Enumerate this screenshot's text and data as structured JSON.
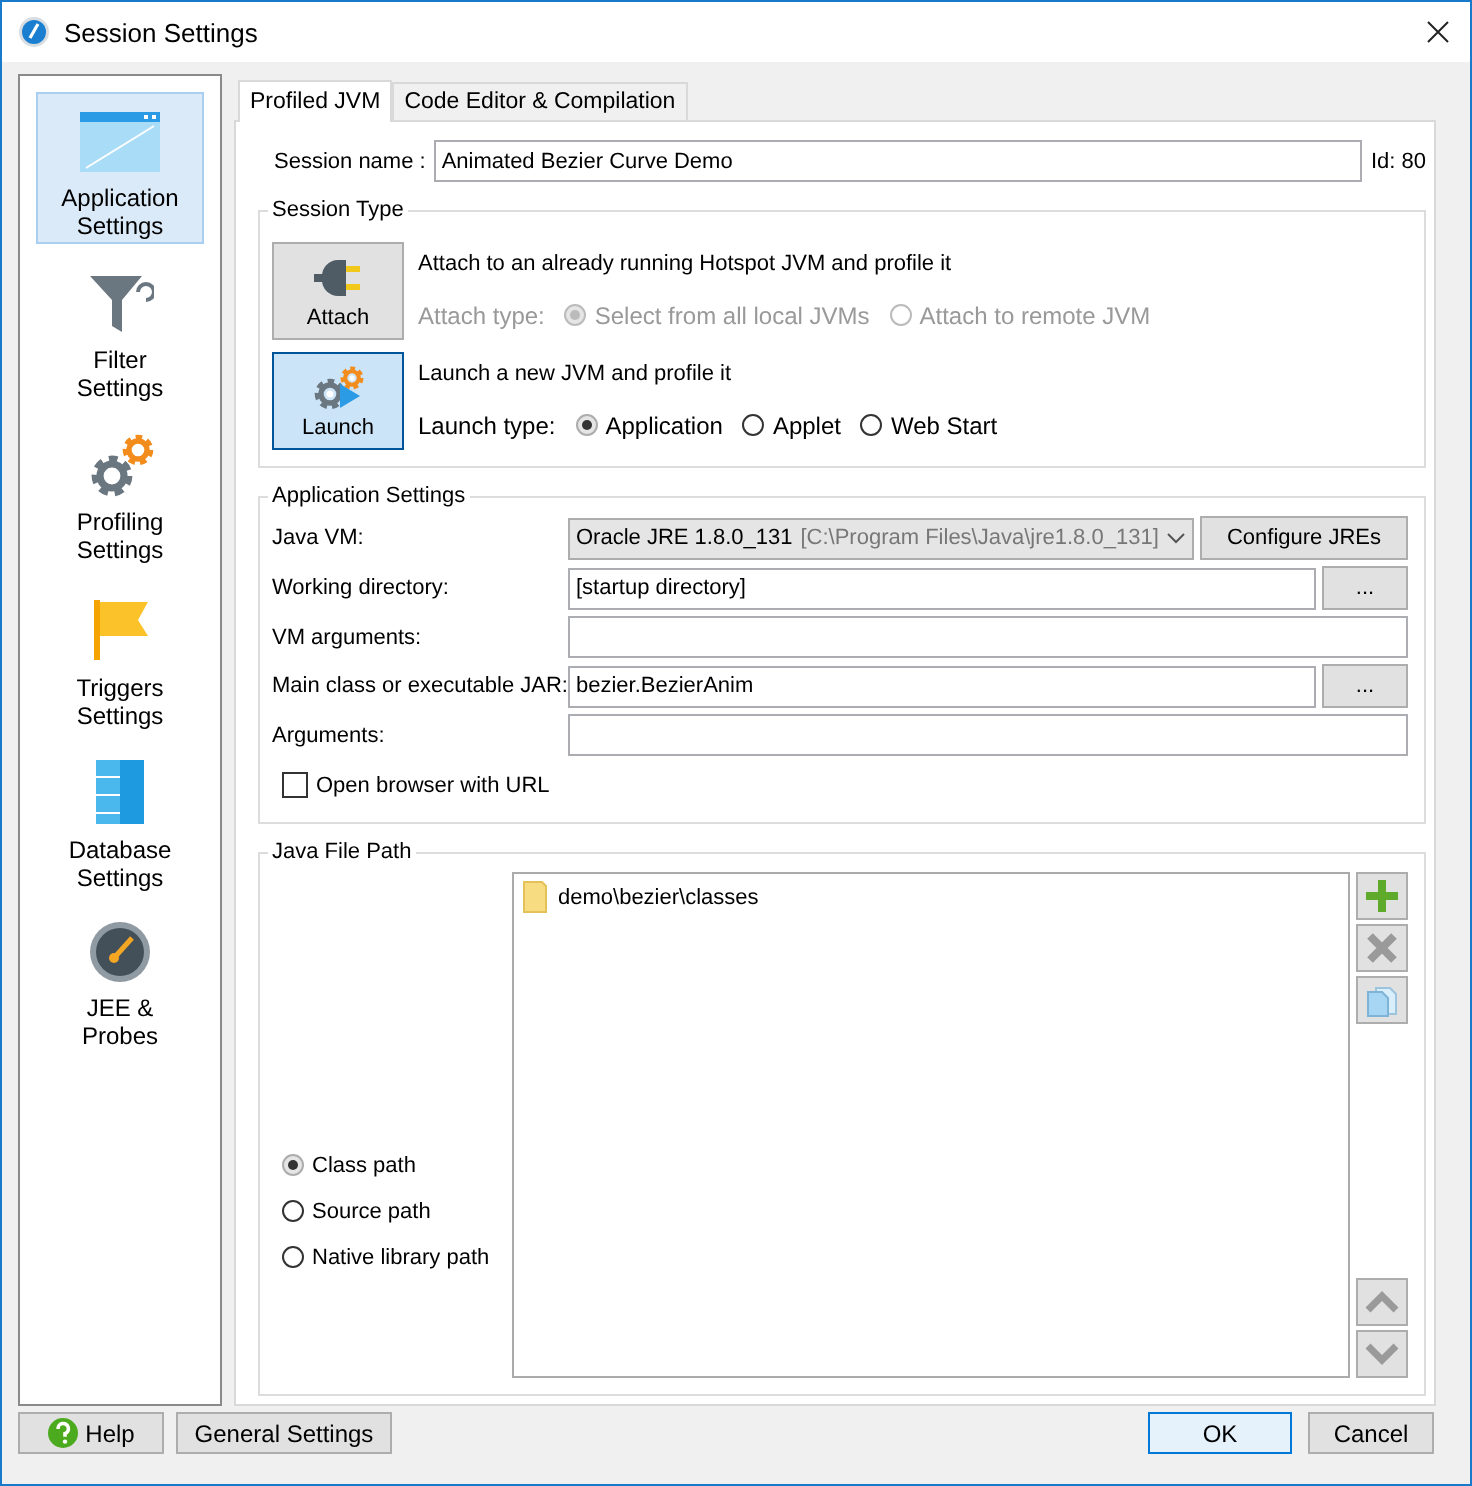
{
  "window": {
    "title": "Session Settings"
  },
  "sidebar": {
    "items": [
      {
        "kind": "window",
        "label": "Application\nSettings",
        "selected": true
      },
      {
        "kind": "filter",
        "label": "Filter\nSettings",
        "selected": false
      },
      {
        "kind": "gears",
        "label": "Profiling\nSettings",
        "selected": false
      },
      {
        "kind": "flag",
        "label": "Triggers\nSettings",
        "selected": false
      },
      {
        "kind": "database",
        "label": "Database\nSettings",
        "selected": false
      },
      {
        "kind": "gauge",
        "label": "JEE &\nProbes",
        "selected": false
      }
    ]
  },
  "tabs": [
    {
      "label": "Profiled JVM",
      "selected": true
    },
    {
      "label": "Code Editor & Compilation",
      "selected": false
    }
  ],
  "session": {
    "label": "Session name :",
    "value": "Animated Bezier Curve Demo",
    "id": "Id: 80"
  },
  "session_type": {
    "title": "Session Type",
    "modes": [
      {
        "kind": "attach",
        "button": "Attach",
        "selected": false,
        "description": "Attach to an already running Hotspot JVM and profile it",
        "type_label": "Attach type:",
        "disabled": true,
        "options": [
          {
            "label": "Select from all local JVMs",
            "selected": true
          },
          {
            "label": "Attach to remote JVM",
            "selected": false
          }
        ]
      },
      {
        "kind": "launch",
        "button": "Launch",
        "selected": true,
        "description": "Launch a new JVM and profile it",
        "type_label": "Launch type:",
        "disabled": false,
        "options": [
          {
            "label": "Application",
            "selected": true
          },
          {
            "label": "Applet",
            "selected": false
          },
          {
            "label": "Web Start",
            "selected": false
          }
        ]
      }
    ]
  },
  "application_settings": {
    "title": "Application Settings",
    "rows": [
      {
        "kind": "select",
        "label": "Java VM:",
        "value": "Oracle JRE 1.8.0_131",
        "detail": "[C:\\Program Files\\Java\\jre1.8.0_131]",
        "button": "Configure JREs"
      },
      {
        "kind": "field",
        "label": "Working directory:",
        "value": "[startup directory]",
        "button": "..."
      },
      {
        "kind": "field",
        "label": "VM arguments:"
      },
      {
        "kind": "field",
        "label": "Main class or executable JAR:",
        "value": "bezier.BezierAnim",
        "button": "..."
      },
      {
        "kind": "field",
        "label": "Arguments:"
      }
    ],
    "checkbox": {
      "label": "Open browser with URL",
      "checked": false
    }
  },
  "java_file_path": {
    "title": "Java File Path",
    "path_types": [
      {
        "label": "Class path",
        "selected": true
      },
      {
        "label": "Source path",
        "selected": false
      },
      {
        "label": "Native library path",
        "selected": false
      }
    ],
    "entries": [
      "demo\\bezier\\classes"
    ]
  },
  "footer": {
    "left": [
      {
        "kind": "help",
        "label": "Help"
      },
      {
        "kind": "plain",
        "label": "General Settings"
      }
    ],
    "right": [
      {
        "label": "OK",
        "focused": true
      },
      {
        "label": "Cancel",
        "focused": false
      }
    ]
  }
}
